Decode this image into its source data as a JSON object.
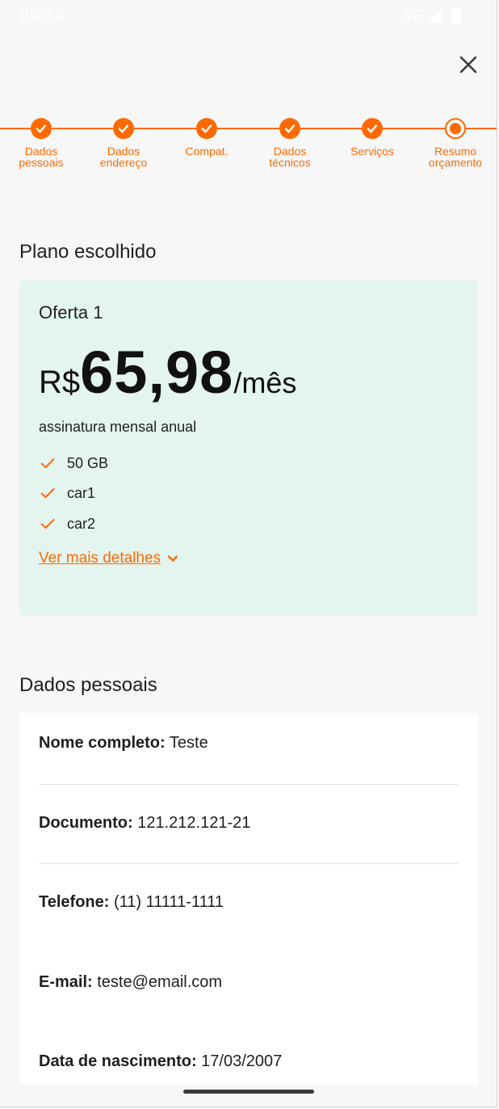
{
  "status_bar": {
    "time": "09:14",
    "network": "5G"
  },
  "stepper": {
    "steps": [
      {
        "label_line1": "Dados",
        "label_line2": "pessoais",
        "state": "done"
      },
      {
        "label_line1": "Dados",
        "label_line2": "endereço",
        "state": "done"
      },
      {
        "label_line1": "Compat.",
        "label_line2": "",
        "state": "done"
      },
      {
        "label_line1": "Dados",
        "label_line2": "técnicos",
        "state": "done"
      },
      {
        "label_line1": "Serviços",
        "label_line2": "",
        "state": "done"
      },
      {
        "label_line1": "Resumo",
        "label_line2": "orçamento",
        "state": "current"
      }
    ]
  },
  "plan": {
    "section_title": "Plano escolhido",
    "offer_title": "Oferta 1",
    "currency": "R$",
    "price": "65,98",
    "period": "/mês",
    "subtitle": "assinatura mensal anual",
    "features": [
      "50 GB",
      "car1",
      "car2"
    ],
    "more_details": "Ver mais detalhes"
  },
  "personal": {
    "section_title": "Dados pessoais",
    "fields": [
      {
        "label": "Nome completo:",
        "value": "Teste"
      },
      {
        "label": "Documento:",
        "value": "121.212.121-21"
      },
      {
        "label": "Telefone:",
        "value": "(11) 11111-1111"
      },
      {
        "label": "E-mail:",
        "value": "teste@email.com"
      },
      {
        "label": "Data de nascimento:",
        "value": "17/03/2007"
      }
    ]
  },
  "colors": {
    "accent": "#ff6a00",
    "plan_card_bg": "#e4f4ee",
    "page_bg": "#f7f7f7"
  },
  "icons": {
    "close": "close-icon",
    "check": "check-icon",
    "chevron": "chevron-down-icon"
  }
}
